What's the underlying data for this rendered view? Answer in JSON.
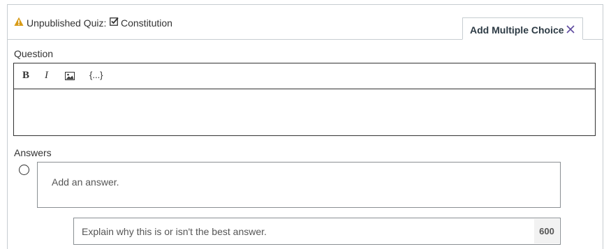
{
  "header": {
    "status_text": "Unpublished Quiz:",
    "quiz_title": "Constitution",
    "warning_color": "#d89b17",
    "status_icon": "warning-icon",
    "quiz_icon": "checkbox-checked-icon"
  },
  "tab": {
    "label": "Add Multiple Choice",
    "close_icon": "close-icon",
    "close_color": "#5f4ba0"
  },
  "question": {
    "label": "Question",
    "toolbar": {
      "bold": "B",
      "italic": "I",
      "image_icon": "image-icon",
      "equation": "{...}"
    },
    "body_value": ""
  },
  "answers": {
    "label": "Answers",
    "items": [
      {
        "placeholder": "Add an answer.",
        "feedback_placeholder": "Explain why this is or isn't the best answer.",
        "char_limit": "600"
      }
    ]
  }
}
